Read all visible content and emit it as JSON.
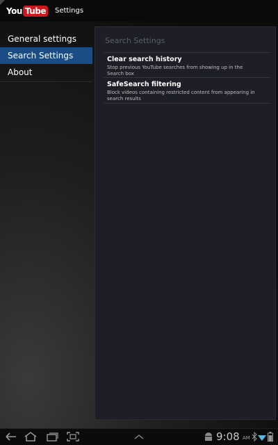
{
  "app": {
    "logo_you": "You",
    "logo_tube": "Tube",
    "title": "Settings"
  },
  "nav": {
    "items": [
      {
        "label": "General settings",
        "selected": false
      },
      {
        "label": "Search Settings",
        "selected": true
      },
      {
        "label": "About",
        "selected": false
      }
    ]
  },
  "panel": {
    "header": "Search Settings",
    "prefs": [
      {
        "title": "Clear search history",
        "summary": "Stop previous YouTube searches from showing up in the Search box"
      },
      {
        "title": "SafeSearch filtering",
        "summary": "Block videos containing restricted content from appearing in search results"
      }
    ]
  },
  "statusbar": {
    "time": "9:08",
    "ampm": "AM",
    "icons": [
      "back-icon",
      "home-icon",
      "recent-apps-icon",
      "screenshot-icon",
      "chevron-up-icon",
      "android-icon",
      "bluetooth-icon",
      "wifi-icon",
      "battery-icon"
    ],
    "selection_color": "#1c4c86",
    "logo_color": "#cc181e"
  }
}
